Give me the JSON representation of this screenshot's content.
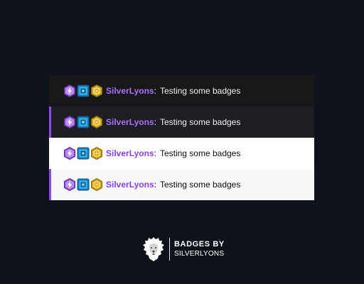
{
  "chat_preview": {
    "rows": [
      {
        "theme": "dark",
        "highlighted": false,
        "username": "SilverLyons",
        "separator": ":",
        "message": "Testing some badges"
      },
      {
        "theme": "dark",
        "highlighted": true,
        "username": "SilverLyons",
        "separator": ":",
        "message": "Testing some badges"
      },
      {
        "theme": "light",
        "highlighted": false,
        "username": "SilverLyons",
        "separator": ":",
        "message": "Testing some badges"
      },
      {
        "theme": "light",
        "highlighted": true,
        "username": "SilverLyons",
        "separator": ":",
        "message": "Testing some badges"
      }
    ],
    "badges": [
      "purple-lightning-badge-icon",
      "blue-prime-badge-icon",
      "gold-hexagon-badge-icon"
    ]
  },
  "branding": {
    "line1": "BADGES BY",
    "line2": "SILVERLYONS",
    "logo": "lion-head-icon"
  },
  "colors": {
    "background": "#0e121a",
    "highlight_accent": "#9147ff",
    "username_dark": "#a970ff",
    "username_light": "#8c3cf5"
  }
}
